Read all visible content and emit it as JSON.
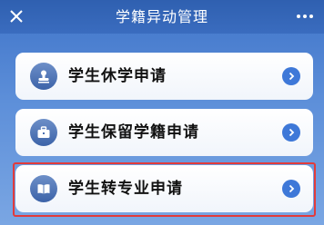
{
  "header": {
    "title": "学籍异动管理",
    "close_icon": "close-icon",
    "more_icon": "more-icon"
  },
  "items": [
    {
      "label": "学生休学申请",
      "icon": "stamp-icon"
    },
    {
      "label": "学生保留学籍申请",
      "icon": "briefcase-icon"
    },
    {
      "label": "学生转专业申请",
      "icon": "book-icon"
    }
  ],
  "colors": {
    "header_bg": "#2f60b0",
    "page_bg": "#5d8fd9",
    "chevron_bg": "#3e78d8",
    "highlight": "#e23b3b",
    "icon_bg": "#4a6fb0"
  }
}
